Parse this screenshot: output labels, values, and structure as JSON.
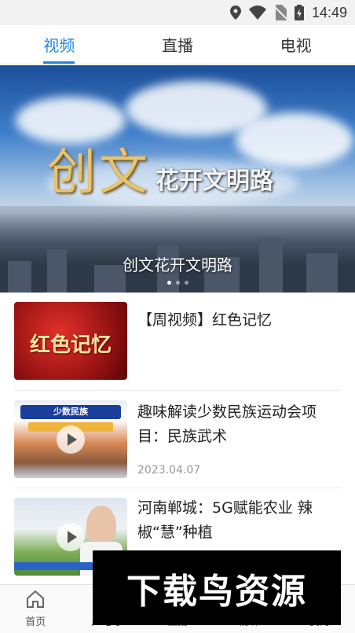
{
  "status_bar": {
    "time": "14:49",
    "icons": [
      "location-icon",
      "wifi-icon",
      "no-sim-icon",
      "battery-charging-icon"
    ]
  },
  "tabs": [
    {
      "label": "视频",
      "active": true
    },
    {
      "label": "直播",
      "active": false
    },
    {
      "label": "电视",
      "active": false
    }
  ],
  "banner": {
    "art_big": "创文",
    "art_small": "花开文明路",
    "caption": "创文花开文明路",
    "dots": 3,
    "active_dot": 0
  },
  "videos": [
    {
      "title": "【周视频】红色记忆",
      "thumb_text": "红色记忆",
      "date": "",
      "has_play": false
    },
    {
      "title": "趣味解读少数民族运动会项目：民族武术",
      "thumb_text": "少数民族",
      "date": "2023.04.07",
      "has_play": true
    },
    {
      "title": "河南郸城：5G赋能农业 辣椒“慧”种植",
      "thumb_text": "",
      "date": "",
      "has_play": true
    }
  ],
  "bottom_nav": [
    {
      "label": "首页",
      "icon": "home-icon",
      "active": false
    },
    {
      "label": "广电号",
      "icon": "broadcast-icon",
      "active": false
    },
    {
      "label": "直播",
      "icon": "live-icon",
      "active": false
    },
    {
      "label": "视听",
      "icon": "play-icon",
      "active": true
    },
    {
      "label": "我的",
      "icon": "user-icon",
      "active": false
    }
  ],
  "watermark": "下载鸟资源",
  "colors": {
    "accent": "#1e88e5"
  }
}
